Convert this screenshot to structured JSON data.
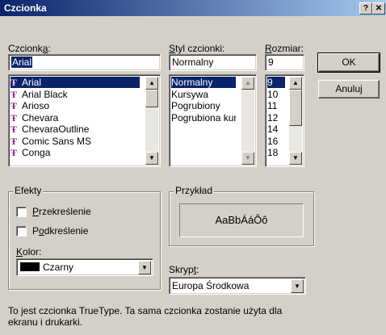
{
  "window": {
    "title": "Czcionka",
    "help_button": "?",
    "close_button": "✕"
  },
  "font": {
    "label_pre": "Czcionk",
    "label_acc": "a",
    "label_post": ":",
    "value": "Arial",
    "items": [
      "Arial",
      "Arial Black",
      "Arioso",
      "Chevara",
      "ChevaraOutline",
      "Comic Sans MS",
      "Conga"
    ],
    "selected_index": 0,
    "item_icon": "truetype-icon"
  },
  "style": {
    "label_acc": "S",
    "label_post": "tyl czcionki:",
    "value": "Normalny",
    "items": [
      "Normalny",
      "Kursywa",
      "Pogrubiony",
      "Pogrubiona kursywa"
    ],
    "selected_index": 0
  },
  "size": {
    "label_acc": "R",
    "label_post": "ozmiar:",
    "value": "9",
    "items": [
      "9",
      "10",
      "11",
      "12",
      "14",
      "16",
      "18"
    ],
    "selected_index": 0
  },
  "buttons": {
    "ok": "OK",
    "cancel": "Anuluj"
  },
  "effects": {
    "title": "Efekty",
    "strikeout_acc": "P",
    "strikeout_post": "rzekreślenie",
    "strikeout_checked": false,
    "underline_pre": "P",
    "underline_acc": "o",
    "underline_post": "dkreślenie",
    "underline_checked": false,
    "color_label_acc": "K",
    "color_label_post": "olor:",
    "color_value": "Czarny",
    "color_swatch": "#000000"
  },
  "preview": {
    "title": "Przykład",
    "sample": "AaBbÁáÔô"
  },
  "script": {
    "label_pre": "Skryp",
    "label_acc": "t",
    "label_post": ":",
    "value": "Europa Środkowa"
  },
  "description": "To jest czcionka TrueType. Ta sama czcionka zostanie użyta dla ekranu i drukarki.",
  "colors": {
    "titlebar_start": "#0a246a",
    "titlebar_end": "#a6caf0",
    "face": "#d4d0c8",
    "selection": "#0a246a"
  }
}
